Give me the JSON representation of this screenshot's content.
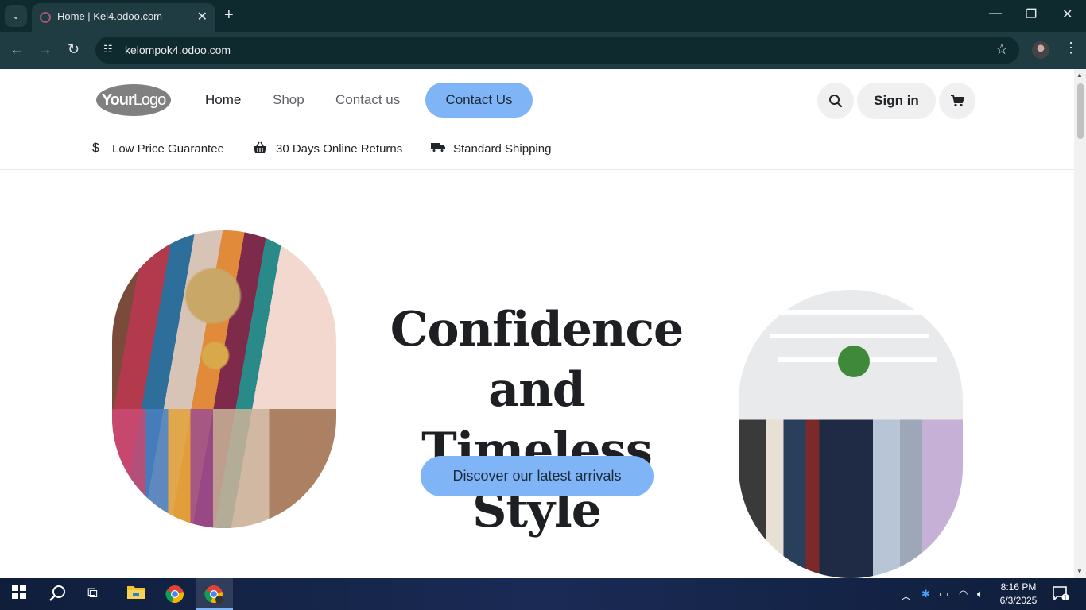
{
  "browser": {
    "tab_title": "Home | Kel4.odoo.com",
    "url": "kelompok4.odoo.com",
    "new_tab_symbol": "+",
    "tab_close_symbol": "✕"
  },
  "header": {
    "logo_bold": "Your",
    "logo_light": "Logo",
    "menu": [
      "Home",
      "Shop",
      "Contact us"
    ],
    "active_menu": "Home",
    "cta_label": "Contact Us",
    "signin_label": "Sign in",
    "search_icon": "search-icon",
    "cart_icon": "cart-icon"
  },
  "perks": [
    {
      "icon": "dollar-icon",
      "label": "Low Price Guarantee"
    },
    {
      "icon": "basket-icon",
      "label": "30 Days Online Returns"
    },
    {
      "icon": "truck-icon",
      "label": "Standard Shipping"
    }
  ],
  "hero": {
    "title_line1": "Confidence and",
    "title_line2": "Timeless Style",
    "cta_label": "Discover our latest arrivals"
  },
  "taskbar": {
    "time": "8:16 PM",
    "date": "6/3/2025",
    "notification_count": "1"
  },
  "colors": {
    "accent": "#7fb5f7",
    "chrome_dark": "#0f2a2e",
    "chrome_mid": "#1f3c42"
  }
}
